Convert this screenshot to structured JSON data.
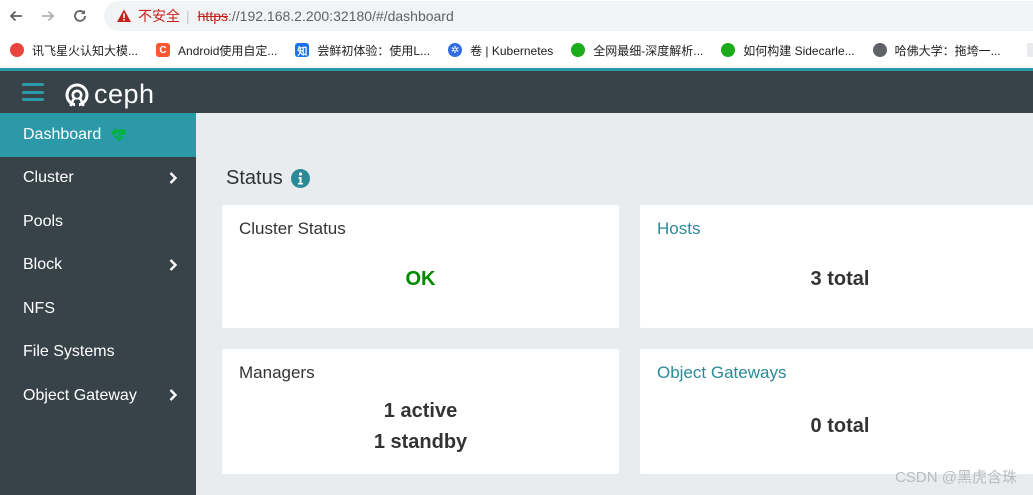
{
  "browser": {
    "security_label": "不安全",
    "url_scheme": "https",
    "url_rest": "://192.168.2.200:32180/#/dashboard",
    "bookmarks": [
      {
        "label": "讯飞星火认知大模...",
        "color": "#e8453c"
      },
      {
        "label": "Android使用自定...",
        "color": "#fc5531"
      },
      {
        "label": "尝鲜初体验：使用L...",
        "color": "#1a73e8"
      },
      {
        "label": "卷 | Kubernetes",
        "color": "#326ce5"
      },
      {
        "label": "全网最细-深度解析...",
        "color": "#1aad19"
      },
      {
        "label": "如何构建 Sidecarle...",
        "color": "#1aad19"
      },
      {
        "label": "哈佛大学：拖垮一...",
        "color": "#5f6368"
      }
    ]
  },
  "app": {
    "logo_text": "ceph",
    "brand_color": "#2b99a8"
  },
  "sidebar": {
    "items": [
      {
        "label": "Dashboard",
        "active": true
      },
      {
        "label": "Cluster",
        "has_submenu": true
      },
      {
        "label": "Pools"
      },
      {
        "label": "Block",
        "has_submenu": true
      },
      {
        "label": "NFS"
      },
      {
        "label": "File Systems"
      },
      {
        "label": "Object Gateway",
        "has_submenu": true
      }
    ]
  },
  "main": {
    "section_title": "Status",
    "cards": {
      "cluster_status": {
        "title": "Cluster Status",
        "value": "OK"
      },
      "hosts": {
        "title": "Hosts",
        "value": "3 total"
      },
      "managers": {
        "title": "Managers",
        "active": "1 active",
        "standby": "1 standby"
      },
      "object_gateways": {
        "title": "Object Gateways",
        "value": "0 total"
      }
    }
  },
  "watermark": "CSDN @黑虎含珠"
}
